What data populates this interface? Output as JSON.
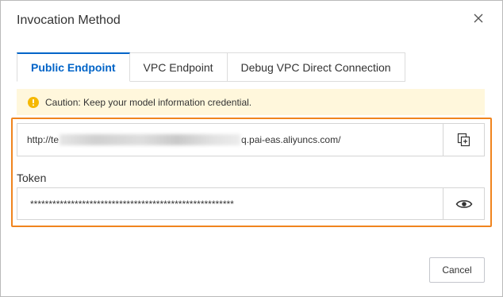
{
  "dialog": {
    "title": "Invocation Method"
  },
  "tabs": [
    {
      "label": "Public Endpoint",
      "active": true
    },
    {
      "label": "VPC Endpoint",
      "active": false
    },
    {
      "label": "Debug VPC Direct Connection",
      "active": false
    }
  ],
  "caution": {
    "text": "Caution: Keep your model information credential."
  },
  "endpoint": {
    "url_prefix": "http://te",
    "url_suffix": "q.pai-eas.aliyuncs.com/"
  },
  "token": {
    "label": "Token",
    "masked_value": "*******************************************************"
  },
  "footer": {
    "cancel_label": "Cancel"
  },
  "colors": {
    "accent": "#0064c8",
    "highlight_border": "#f0841e",
    "caution_bg": "#fff7dc",
    "caution_icon": "#f5b800"
  },
  "icons": {
    "close": "close-icon",
    "caution": "warning-icon",
    "copy": "copy-icon",
    "reveal": "eye-icon"
  }
}
